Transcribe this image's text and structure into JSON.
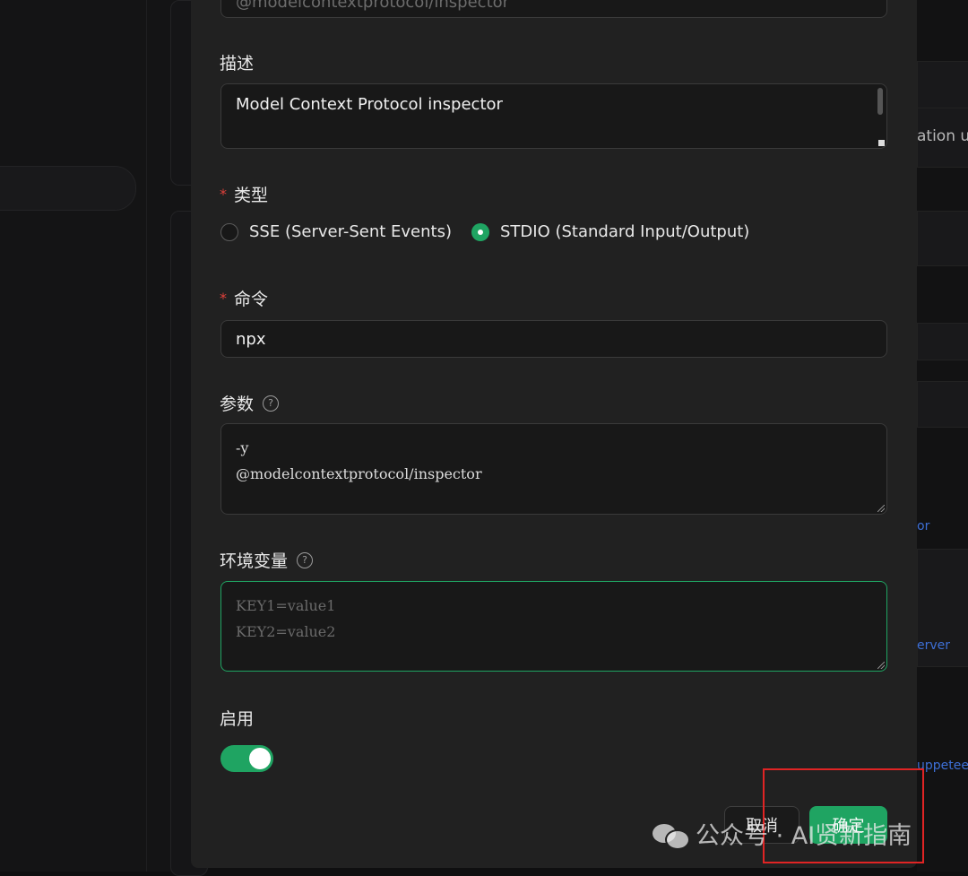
{
  "background": {
    "right_snippets": [
      "ation us",
      "or",
      "erver",
      "uppeteer"
    ]
  },
  "form": {
    "top_field_value": "@modelcontextprotocol/inspector",
    "description": {
      "label": "描述",
      "value": "Model Context Protocol inspector"
    },
    "type": {
      "label": "类型",
      "required_mark": "*",
      "options": [
        "SSE (Server-Sent Events)",
        "STDIO (Standard Input/Output)"
      ],
      "selected": "STDIO (Standard Input/Output)"
    },
    "command": {
      "label": "命令",
      "required_mark": "*",
      "value": "npx"
    },
    "args": {
      "label": "参数",
      "help_icon": "question-circle-icon",
      "lines": [
        "-y",
        "@modelcontextprotocol/inspector"
      ]
    },
    "env": {
      "label": "环境变量",
      "help_icon": "question-circle-icon",
      "placeholder_lines": [
        "KEY1=value1",
        "KEY2=value2"
      ]
    },
    "enabled": {
      "label": "启用",
      "on": true
    }
  },
  "footer": {
    "cancel_label": "取消",
    "ok_label": "确定"
  },
  "watermark": {
    "text": "公众号 · AI贤新指南"
  },
  "colors": {
    "accent": "#1fa462",
    "required": "#e0413b",
    "highlight_box": "#e02424",
    "modal_bg": "#212121"
  }
}
